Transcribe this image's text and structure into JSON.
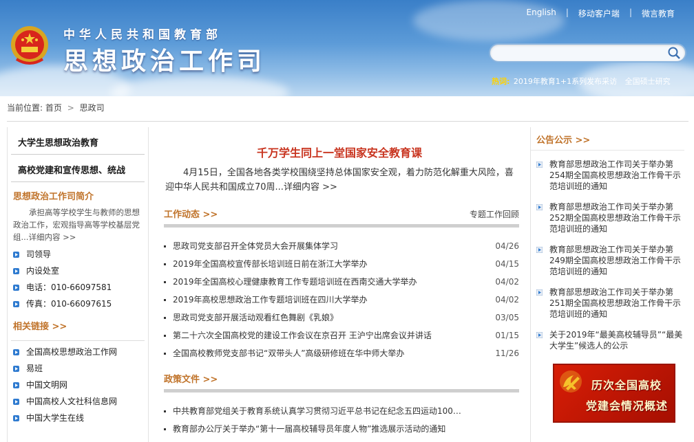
{
  "header": {
    "subtitle": "中华人民共和国教育部",
    "title": "思想政治工作司",
    "top_links": [
      "English",
      "移动客户端",
      "微言教育"
    ],
    "search_placeholder": "",
    "hot_label": "热词:",
    "hot_items": [
      "2019年教育1+1系列发布采访",
      "全国硕士研究"
    ]
  },
  "breadcrumb": {
    "label": "当前位置:",
    "items": [
      "首页",
      "思政司"
    ]
  },
  "left": {
    "nav": [
      "大学生思想政治教育",
      "高校党建和宣传思想、统战"
    ],
    "intro_title": "思想政治工作司简介",
    "intro_text": "承担高等学校学生与教师的思想政治工作，宏观指导高等学校基层党组...详细内容 >>",
    "info_items": [
      "司领导",
      "内设处室",
      "电话：010-66097581",
      "传真：010-66097615"
    ],
    "links_title": "相关链接 >>",
    "links": [
      "全国高校思想政治工作网",
      "易班",
      "中国文明网",
      "中国高校人文社科信息网",
      "中国大学生在线"
    ]
  },
  "center": {
    "headline": "千万学生同上一堂国家安全教育课",
    "summary": "4月15日，全国各地各类学校围绕坚持总体国家安全观，着力防范化解重大风险，喜迎中华人民共和国成立70周...详细内容 >>",
    "work_title": "工作动态 >>",
    "work_right": "专题工作回顾",
    "work_news": [
      {
        "title": "思政司党支部召开全体党员大会开展集体学习",
        "date": "04/26"
      },
      {
        "title": "2019年全国高校宣传部长培训班日前在浙江大学举办",
        "date": "04/15"
      },
      {
        "title": "2019年全国高校心理健康教育工作专题培训班在西南交通大学举办",
        "date": "04/02"
      },
      {
        "title": "2019年高校思想政治工作专题培训班在四川大学举办",
        "date": "04/02"
      },
      {
        "title": "思政司党支部开展活动观看红色舞剧《乳娘》",
        "date": "03/05"
      },
      {
        "title": "第二十六次全国高校党的建设工作会议在京召开 王沪宁出席会议并讲话",
        "date": "01/15"
      },
      {
        "title": "全国高校教师党支部书记“双带头人”高级研修班在华中师大举办",
        "date": "11/26"
      }
    ],
    "policy_title": "政策文件 >>",
    "policy_news": [
      {
        "title": "中共教育部党组关于教育系统认真学习贯彻习近平总书记在纪念五四运动100…",
        "date": ""
      },
      {
        "title": "教育部办公厅关于举办“第十一届高校辅导员年度人物”推选展示活动的通知",
        "date": ""
      }
    ]
  },
  "right": {
    "title": "公告公示 >>",
    "notices": [
      "教育部思想政治工作司关于举办第254期全国高校思想政治工作骨干示范培训班的通知",
      "教育部思想政治工作司关于举办第252期全国高校思想政治工作骨干示范培训班的通知",
      "教育部思想政治工作司关于举办第249期全国高校思想政治工作骨干示范培训班的通知",
      "教育部思想政治工作司关于举办第251期全国高校思想政治工作骨干示范培训班的通知",
      "关于2019年“最美高校辅导员”“最美大学生”候选人的公示"
    ],
    "banner_line1": "历次全国高校",
    "banner_line2": "党建会情况概述"
  },
  "colors": {
    "accent_orange": "#c0732a",
    "headline_red": "#c8341f",
    "header_blue": "#3a7fc8"
  },
  "icons": [
    "national-emblem-icon",
    "search-icon",
    "blue-arrow-bullet-icon",
    "party-flag-icon"
  ]
}
